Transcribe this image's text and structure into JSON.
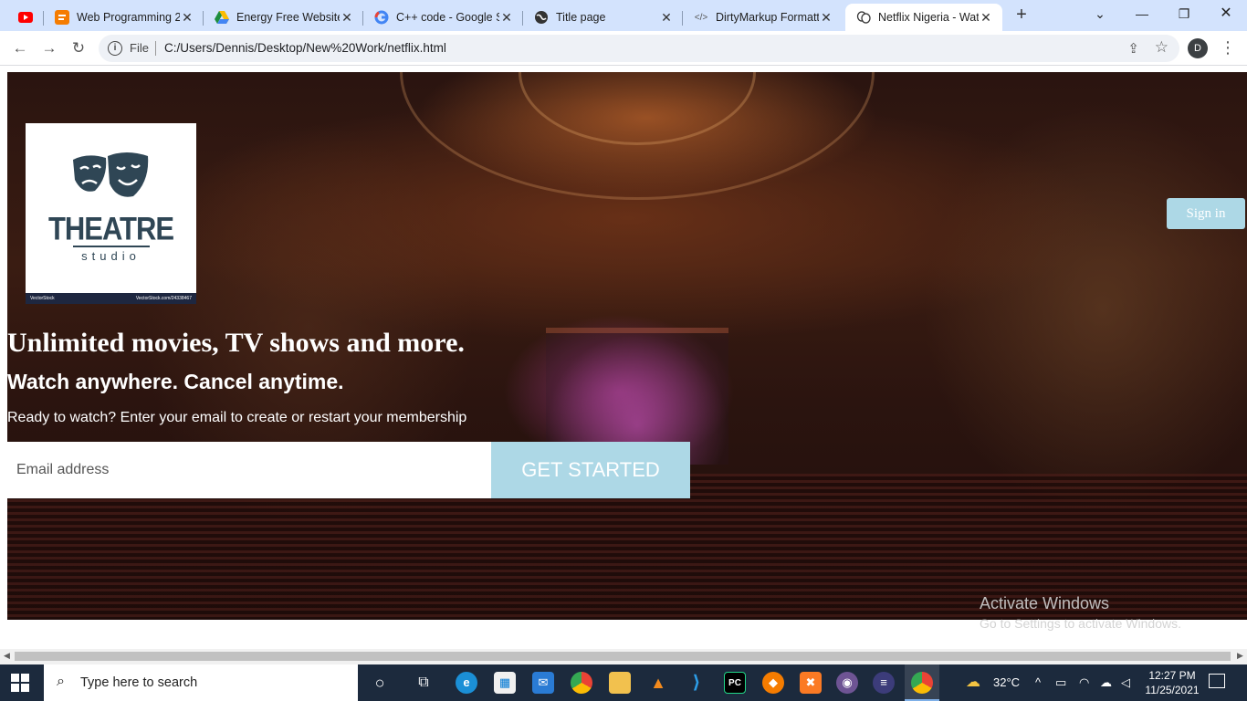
{
  "browser": {
    "tabs": [
      {
        "title": "",
        "favicon": "youtube-icon",
        "color": "#ff0000"
      },
      {
        "title": "Web Programming 2",
        "favicon": "blogger-icon",
        "color": "#f57c00"
      },
      {
        "title": "Energy Free Website",
        "favicon": "drive-icon",
        "color": "#1e8e3e"
      },
      {
        "title": "C++ code - Google S",
        "favicon": "google-icon",
        "color": "#4285f4"
      },
      {
        "title": "Title page",
        "favicon": "globe-icon",
        "color": "#333333"
      },
      {
        "title": "DirtyMarkup Formatt",
        "favicon": "code-icon",
        "color": "#555555"
      },
      {
        "title": "Netflix Nigeria - Wat",
        "favicon": "theatre-masks-icon",
        "color": "#333333"
      }
    ],
    "omnibox": {
      "scheme_label": "File",
      "url": "C:/Users/Dennis/Desktop/New%20Work/netflix.html"
    },
    "profile_initial": "D"
  },
  "page": {
    "logo": {
      "word1": "THEATRE",
      "word2": "studio",
      "strip_left": "VectorStock",
      "strip_right": "VectorStock.com/24338467"
    },
    "signin_label": "Sign in",
    "headline": "Unlimited movies, TV shows and more.",
    "subheadline": "Watch anywhere. Cancel anytime.",
    "prompt": "Ready to watch? Enter your email to create or restart your membership",
    "email_placeholder": "Email address",
    "cta_label": "GET STARTED",
    "accent": "#add8e6"
  },
  "watermark": {
    "line1": "Activate Windows",
    "line2": "Go to Settings to activate Windows."
  },
  "taskbar": {
    "search_placeholder": "Type here to search",
    "weather": "32°C",
    "time": "12:27 PM",
    "date": "11/25/2021"
  }
}
